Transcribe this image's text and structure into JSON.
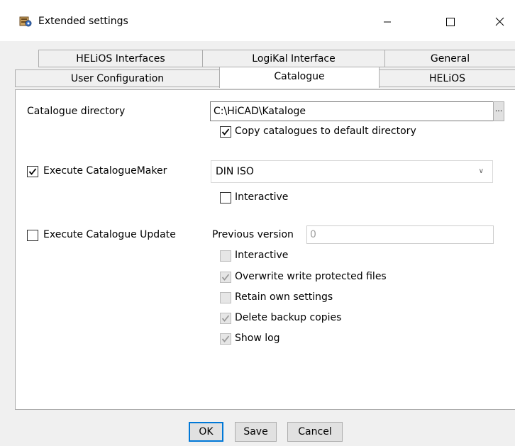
{
  "window": {
    "title": "Extended settings"
  },
  "tabs": {
    "row_top": [
      {
        "label": "HELiOS Interfaces"
      },
      {
        "label": "LogiKal Interface"
      },
      {
        "label": "General"
      }
    ],
    "row_bottom": [
      {
        "label": "User Configuration"
      },
      {
        "label": "Catalogue"
      },
      {
        "label": "HELiOS"
      }
    ],
    "active": "Catalogue"
  },
  "catalogue": {
    "directory_label": "Catalogue directory",
    "directory_value": "C:\\HiCAD\\Kataloge",
    "browse_label": "...",
    "copy_to_default": {
      "label": "Copy catalogues to default directory",
      "checked": true
    },
    "execute_maker": {
      "label": "Execute CatalogueMaker",
      "checked": true
    },
    "maker_standard": "DIN ISO",
    "maker_interactive": {
      "label": "Interactive",
      "checked": false
    },
    "execute_update": {
      "label": "Execute Catalogue Update",
      "checked": false
    },
    "previous_version_label": "Previous version",
    "previous_version_value": "0",
    "update_options": [
      {
        "label": "Interactive",
        "checked": false
      },
      {
        "label": "Overwrite write protected files",
        "checked": true
      },
      {
        "label": "Retain own settings",
        "checked": false
      },
      {
        "label": "Delete backup copies",
        "checked": true
      },
      {
        "label": "Show log",
        "checked": true
      }
    ]
  },
  "buttons": {
    "ok": "OK",
    "save": "Save",
    "cancel": "Cancel"
  }
}
